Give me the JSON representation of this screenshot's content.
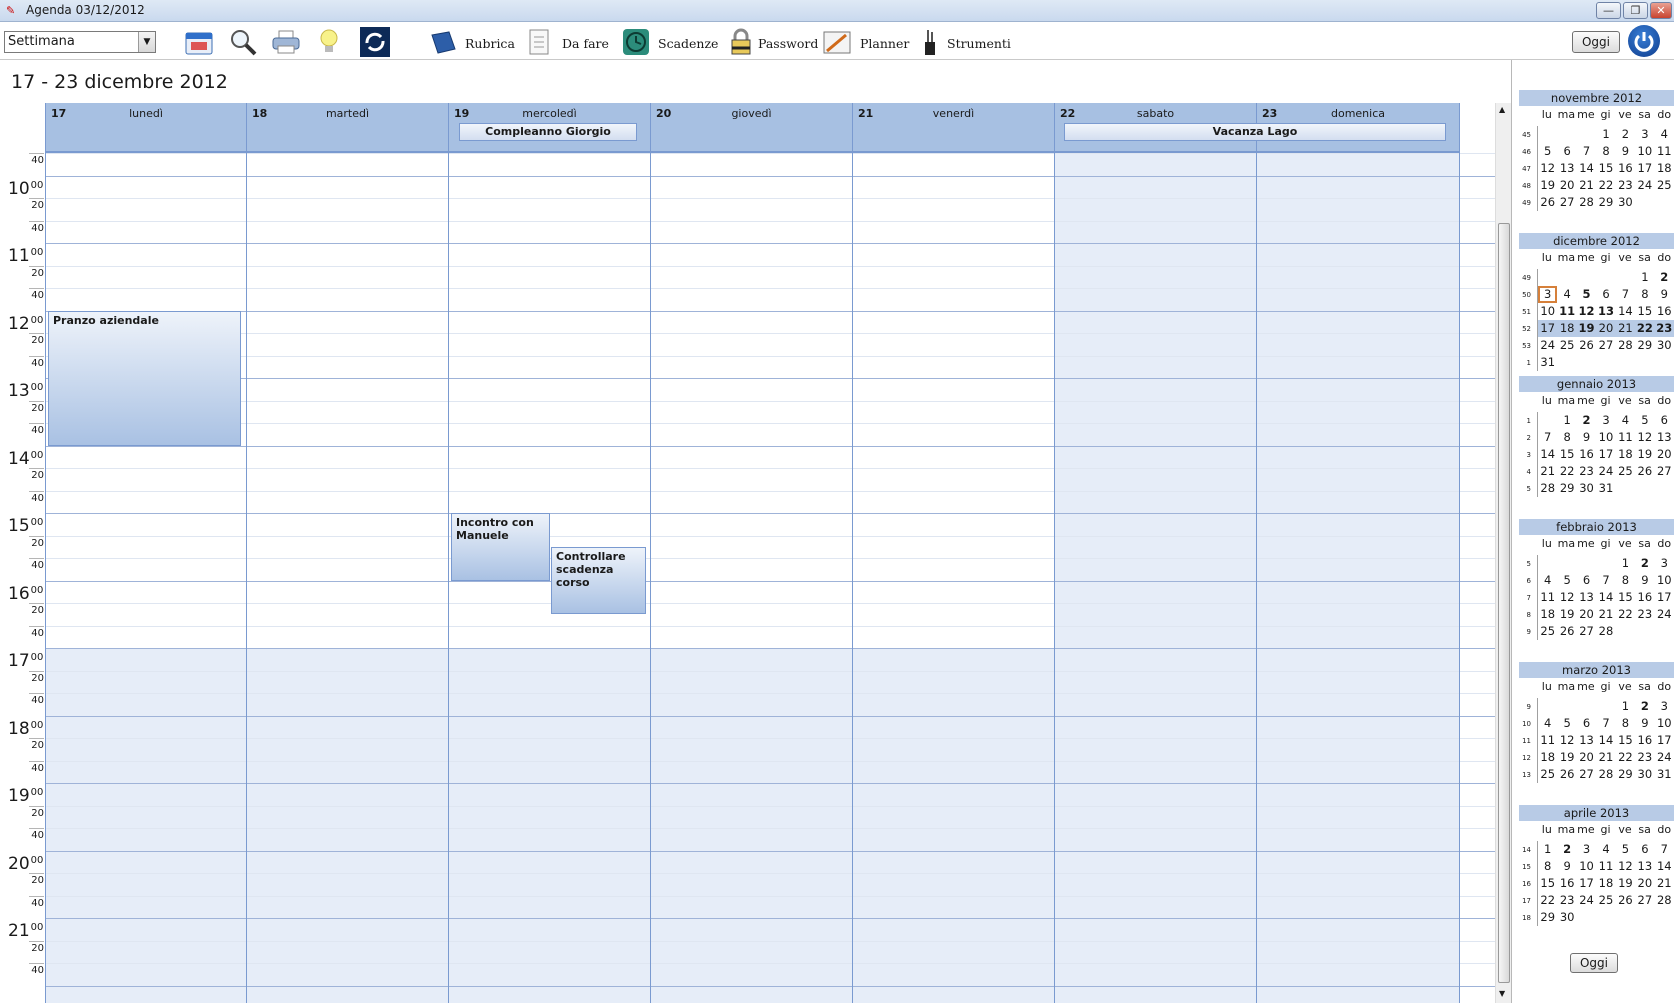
{
  "window": {
    "title": "Agenda 03/12/2012",
    "min": "—",
    "max": "❐",
    "close": "✕"
  },
  "toolbar": {
    "view_select": "Settimana",
    "items": [
      {
        "label": "Rubrica",
        "icon": "address-book-icon"
      },
      {
        "label": "Da fare",
        "icon": "todo-list-icon"
      },
      {
        "label": "Scadenze",
        "icon": "clock-icon"
      },
      {
        "label": "Password",
        "icon": "lock-icon"
      },
      {
        "label": "Planner",
        "icon": "planner-icon"
      },
      {
        "label": "Strumenti",
        "icon": "tools-icon"
      }
    ],
    "today_button": "Oggi"
  },
  "week_title": "17 - 23 dicembre 2012",
  "days": [
    {
      "num": "17",
      "name": "lunedì"
    },
    {
      "num": "18",
      "name": "martedì"
    },
    {
      "num": "19",
      "name": "mercoledì"
    },
    {
      "num": "20",
      "name": "giovedì"
    },
    {
      "num": "21",
      "name": "venerdì"
    },
    {
      "num": "22",
      "name": "sabato"
    },
    {
      "num": "23",
      "name": "domenica"
    }
  ],
  "allday_events": [
    {
      "title": "Compleanno Giorgio"
    },
    {
      "title": "Vacanza Lago"
    }
  ],
  "hours": [
    "10",
    "11",
    "12",
    "13",
    "14",
    "15",
    "16",
    "17",
    "18",
    "19",
    "20",
    "21"
  ],
  "minute_marks": {
    "m20": "20",
    "m40": "40",
    "m00": "00"
  },
  "events": [
    {
      "title": "Pranzo aziendale",
      "day": 0,
      "start": "12:00",
      "end": "14:00"
    },
    {
      "title": "Incontro con Manuele",
      "day": 2,
      "start": "15:00",
      "end": "16:00"
    },
    {
      "title": "Controllare scadenza corso",
      "day": 2,
      "start": "15:30",
      "end": "16:30"
    }
  ],
  "mini_calendar": {
    "dow": [
      "lu",
      "ma",
      "me",
      "gi",
      "ve",
      "sa",
      "do"
    ],
    "months": [
      {
        "title": "novembre 2012",
        "weeks": [
          {
            "wk": "45",
            "d": [
              "",
              "",
              "",
              "1",
              "2",
              "3",
              "4"
            ]
          },
          {
            "wk": "46",
            "d": [
              "5",
              "6",
              "7",
              "8",
              "9",
              "10",
              "11"
            ]
          },
          {
            "wk": "47",
            "d": [
              "12",
              "13",
              "14",
              "15",
              "16",
              "17",
              "18"
            ]
          },
          {
            "wk": "48",
            "d": [
              "19",
              "20",
              "21",
              "22",
              "23",
              "24",
              "25"
            ]
          },
          {
            "wk": "49",
            "d": [
              "26",
              "27",
              "28",
              "29",
              "30",
              "",
              ""
            ]
          }
        ]
      },
      {
        "title": "dicembre 2012",
        "weeks": [
          {
            "wk": "49",
            "d": [
              "",
              "",
              "",
              "",
              "",
              "1",
              "2"
            ]
          },
          {
            "wk": "50",
            "d": [
              "3",
              "4",
              "5",
              "6",
              "7",
              "8",
              "9"
            ]
          },
          {
            "wk": "51",
            "d": [
              "10",
              "11",
              "12",
              "13",
              "14",
              "15",
              "16"
            ]
          },
          {
            "wk": "52",
            "d": [
              "17",
              "18",
              "19",
              "20",
              "21",
              "22",
              "23"
            ]
          },
          {
            "wk": "53",
            "d": [
              "24",
              "25",
              "26",
              "27",
              "28",
              "29",
              "30"
            ]
          },
          {
            "wk": "1",
            "d": [
              "31",
              "",
              "",
              "",
              "",
              "",
              ""
            ]
          }
        ]
      },
      {
        "title": "gennaio 2013",
        "weeks": [
          {
            "wk": "1",
            "d": [
              "",
              "1",
              "2",
              "3",
              "4",
              "5",
              "6"
            ]
          },
          {
            "wk": "2",
            "d": [
              "7",
              "8",
              "9",
              "10",
              "11",
              "12",
              "13"
            ]
          },
          {
            "wk": "3",
            "d": [
              "14",
              "15",
              "16",
              "17",
              "18",
              "19",
              "20"
            ]
          },
          {
            "wk": "4",
            "d": [
              "21",
              "22",
              "23",
              "24",
              "25",
              "26",
              "27"
            ]
          },
          {
            "wk": "5",
            "d": [
              "28",
              "29",
              "30",
              "31",
              "",
              "",
              ""
            ]
          }
        ]
      },
      {
        "title": "febbraio 2013",
        "weeks": [
          {
            "wk": "5",
            "d": [
              "",
              "",
              "",
              "",
              "1",
              "2",
              "3"
            ]
          },
          {
            "wk": "6",
            "d": [
              "4",
              "5",
              "6",
              "7",
              "8",
              "9",
              "10"
            ]
          },
          {
            "wk": "7",
            "d": [
              "11",
              "12",
              "13",
              "14",
              "15",
              "16",
              "17"
            ]
          },
          {
            "wk": "8",
            "d": [
              "18",
              "19",
              "20",
              "21",
              "22",
              "23",
              "24"
            ]
          },
          {
            "wk": "9",
            "d": [
              "25",
              "26",
              "27",
              "28",
              "",
              "",
              ""
            ]
          }
        ]
      },
      {
        "title": "marzo 2013",
        "weeks": [
          {
            "wk": "9",
            "d": [
              "",
              "",
              "",
              "",
              "1",
              "2",
              "3"
            ]
          },
          {
            "wk": "10",
            "d": [
              "4",
              "5",
              "6",
              "7",
              "8",
              "9",
              "10"
            ]
          },
          {
            "wk": "11",
            "d": [
              "11",
              "12",
              "13",
              "14",
              "15",
              "16",
              "17"
            ]
          },
          {
            "wk": "12",
            "d": [
              "18",
              "19",
              "20",
              "21",
              "22",
              "23",
              "24"
            ]
          },
          {
            "wk": "13",
            "d": [
              "25",
              "26",
              "27",
              "28",
              "29",
              "30",
              "31"
            ]
          }
        ]
      },
      {
        "title": "aprile 2013",
        "weeks": [
          {
            "wk": "14",
            "d": [
              "1",
              "2",
              "3",
              "4",
              "5",
              "6",
              "7"
            ]
          },
          {
            "wk": "15",
            "d": [
              "8",
              "9",
              "10",
              "11",
              "12",
              "13",
              "14"
            ]
          },
          {
            "wk": "16",
            "d": [
              "15",
              "16",
              "17",
              "18",
              "19",
              "20",
              "21"
            ]
          },
          {
            "wk": "17",
            "d": [
              "22",
              "23",
              "24",
              "25",
              "26",
              "27",
              "28"
            ]
          },
          {
            "wk": "18",
            "d": [
              "29",
              "30",
              "",
              "",
              "",
              "",
              ""
            ]
          }
        ]
      }
    ],
    "bold_days": {
      "dicembre 2012": [
        "2",
        "5",
        "11",
        "12",
        "13",
        "19",
        "22",
        "23"
      ],
      "gennaio 2013": [
        "2"
      ],
      "febbraio 2013": [
        "2"
      ],
      "marzo 2013": [
        "2"
      ],
      "aprile 2013": [
        "2"
      ]
    },
    "selected_week": {
      "month": "dicembre 2012",
      "wk": "52"
    },
    "today": {
      "month": "dicembre 2012",
      "day": "3"
    },
    "today_button": "Oggi"
  },
  "colors": {
    "header": "#a7c0e2",
    "weekend_bg": "#e6edf8",
    "grid_line": "#7a9ad0",
    "selection": "#b8cbe6",
    "today_outline": "#d6803a"
  }
}
